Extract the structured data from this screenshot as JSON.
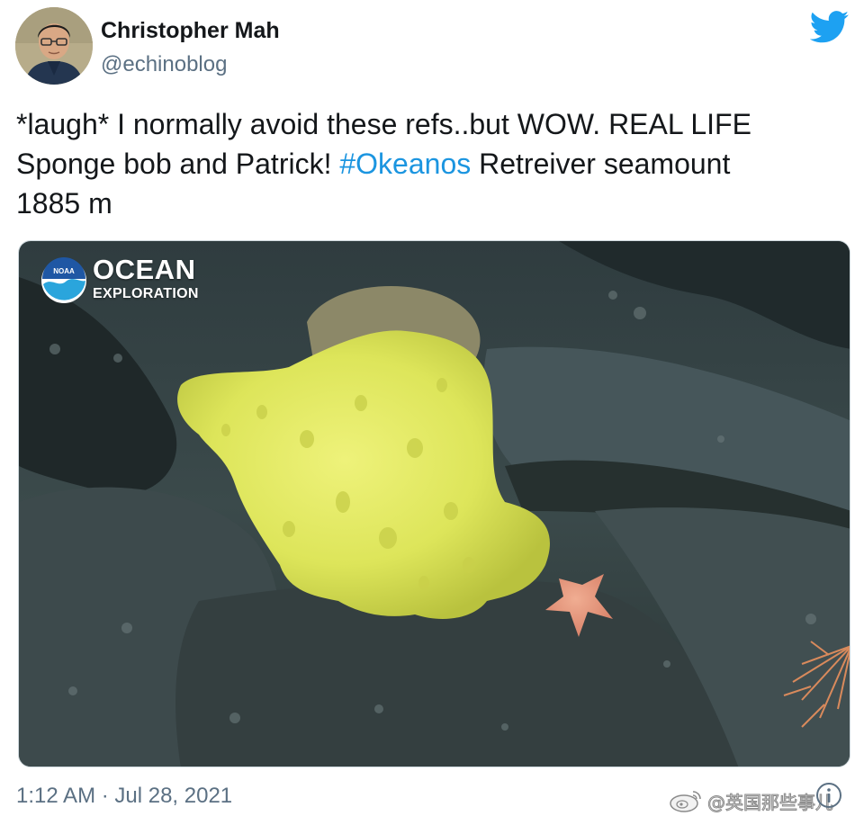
{
  "tweet": {
    "author": {
      "name": "Christopher Mah",
      "handle": "@echinoblog",
      "avatar_icon": "user-avatar"
    },
    "platform_icon": "twitter-bird-icon",
    "text_lines": [
      {
        "before": "*laugh* I normally avoid these refs..but WOW. REAL LIFE",
        "hashtag": "",
        "after": ""
      },
      {
        "before": "Sponge bob and Patrick! ",
        "hashtag": "#Okeanos",
        "after": " Retreiver seamount"
      },
      {
        "before": "1885 m",
        "hashtag": "",
        "after": ""
      }
    ],
    "media": {
      "logo": {
        "badge_text": "NOAA",
        "title": "OCEAN",
        "subtitle": "EXPLORATION"
      }
    },
    "timestamp": "1:12 AM · Jul 28, 2021",
    "info_icon": "info-icon"
  },
  "watermark": {
    "text": "@英国那些事儿",
    "icon": "weibo-icon"
  },
  "colors": {
    "hashtag": "#1b95e0",
    "twitter_blue": "#1da1f2",
    "secondary_text": "#5b7083",
    "sponge_yellow": "#dfe85a",
    "starfish_orange": "#e89a7c"
  }
}
